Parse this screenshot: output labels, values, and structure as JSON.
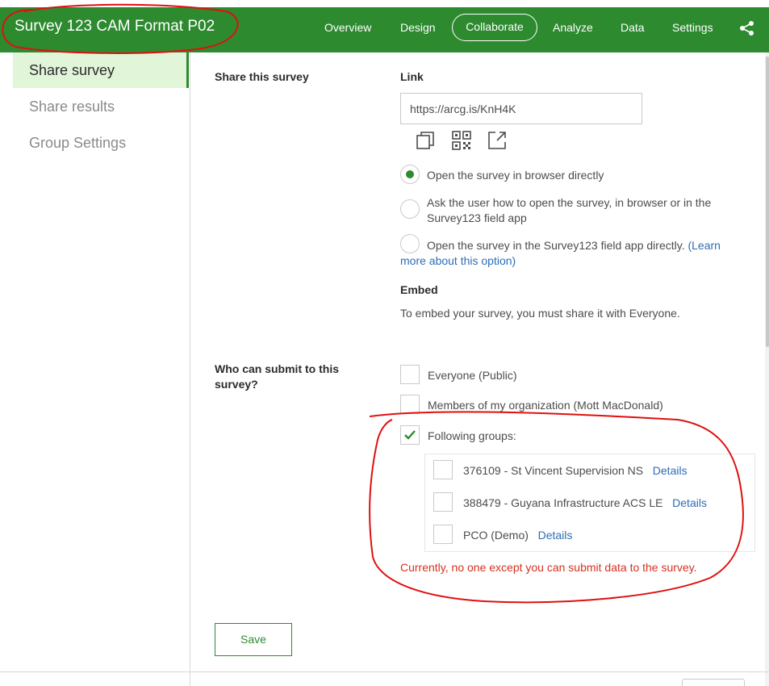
{
  "header": {
    "app_title": "Survey 123 CAM Format P02",
    "tabs": [
      {
        "label": "Overview"
      },
      {
        "label": "Design"
      },
      {
        "label": "Collaborate"
      },
      {
        "label": "Analyze"
      },
      {
        "label": "Data"
      },
      {
        "label": "Settings"
      }
    ],
    "active_tab": "Collaborate",
    "share_icon": "share-icon"
  },
  "sidebar": {
    "items": [
      {
        "label": "Share survey",
        "active": true
      },
      {
        "label": "Share results",
        "active": false
      },
      {
        "label": "Group Settings",
        "active": false
      }
    ]
  },
  "share": {
    "section_title": "Share this survey",
    "link_heading": "Link",
    "link_value": "https://arcg.is/KnH4K",
    "icons": [
      "copy-icon",
      "qr-code-icon",
      "open-external-icon"
    ],
    "options": [
      {
        "label": "Open the survey in browser directly",
        "selected": true
      },
      {
        "label_line1": "Ask the user how to open the survey, in browser or in the",
        "label_line2": "Survey123 field app",
        "selected": false
      },
      {
        "label": "Open the survey in the Survey123 field app directly.",
        "link_part1": "(Learn",
        "link_part2": "more about this option)",
        "selected": false
      }
    ],
    "embed_heading": "Embed",
    "embed_text": "To embed your survey, you must share it with Everyone."
  },
  "submit": {
    "heading_line1": "Who can submit to this",
    "heading_line2": "survey?",
    "options": [
      {
        "label": "Everyone (Public)",
        "checked": false
      },
      {
        "label": "Members of my organization (Mott MacDonald)",
        "checked": false
      },
      {
        "label": "Following groups:",
        "checked": true
      }
    ],
    "groups": [
      {
        "name": "376109 - St Vincent Supervision NS",
        "details": "Details",
        "checked": false
      },
      {
        "name": "388479 - Guyana Infrastructure ACS LE",
        "details": "Details",
        "checked": false
      },
      {
        "name": "PCO (Demo)",
        "details": "Details",
        "checked": false
      }
    ],
    "warning": "Currently, no one except you can submit data to the survey."
  },
  "actions": {
    "save_label": "Save"
  },
  "colors": {
    "brand_green": "#2d8a2f",
    "sidebar_active": "#e1f5d9",
    "link_blue": "#2d6db5",
    "warning_red": "#d83020",
    "annotation_red": "#e01010"
  }
}
